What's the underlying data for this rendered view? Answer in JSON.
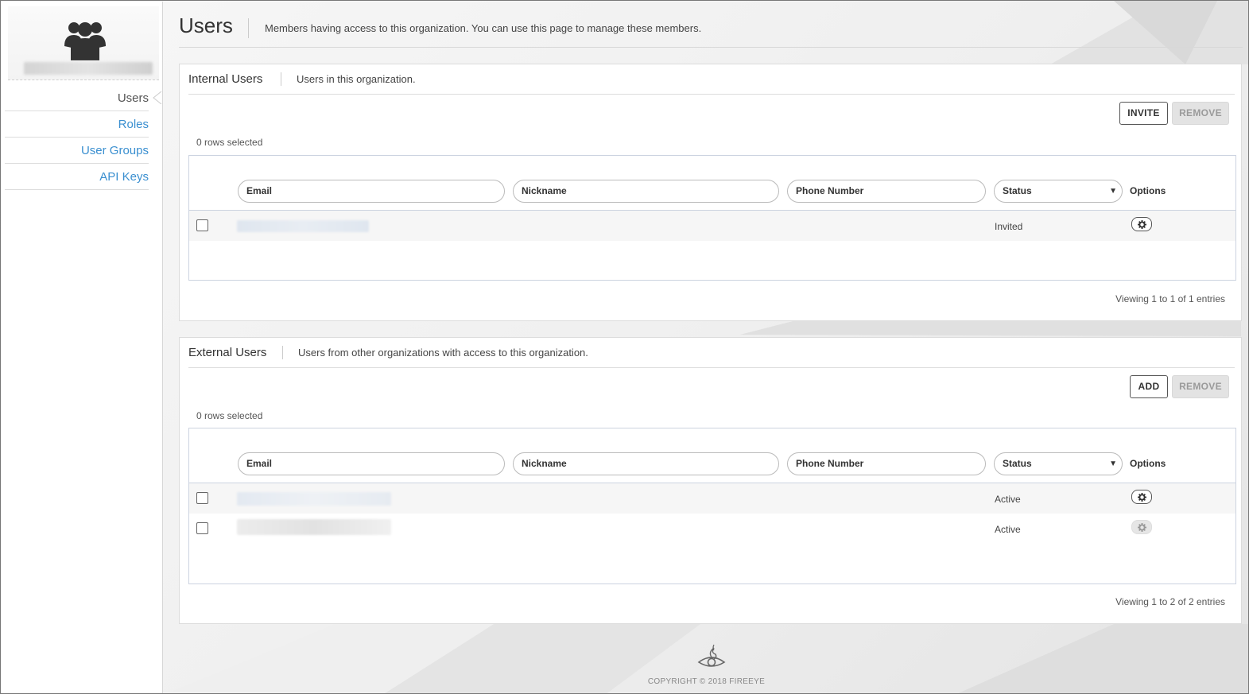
{
  "sidebar": {
    "org_icon": "users-group-icon",
    "items": [
      {
        "label": "Users",
        "active": true
      },
      {
        "label": "Roles",
        "active": false
      },
      {
        "label": "User Groups",
        "active": false
      },
      {
        "label": "API Keys",
        "active": false
      }
    ]
  },
  "header": {
    "title": "Users",
    "description": "Members having access to this organization. You can use this page to manage these members."
  },
  "internal_users": {
    "title": "Internal Users",
    "description": "Users in this organization.",
    "primary_button": "INVITE",
    "remove_button": "REMOVE",
    "rows_selected": "0 rows selected",
    "columns": {
      "email": "Email",
      "nickname": "Nickname",
      "phone": "Phone Number",
      "status": "Status",
      "options": "Options"
    },
    "rows": [
      {
        "status": "Invited",
        "options_enabled": true
      }
    ],
    "viewing": "Viewing 1 to 1 of 1 entries"
  },
  "external_users": {
    "title": "External Users",
    "description": "Users from other organizations with access to this organization.",
    "primary_button": "ADD",
    "remove_button": "REMOVE",
    "rows_selected": "0 rows selected",
    "columns": {
      "email": "Email",
      "nickname": "Nickname",
      "phone": "Phone Number",
      "status": "Status",
      "options": "Options"
    },
    "rows": [
      {
        "status": "Active",
        "options_enabled": true
      },
      {
        "status": "Active",
        "options_enabled": false
      }
    ],
    "viewing": "Viewing 1 to 2 of 2 entries"
  },
  "footer": {
    "logo_icon": "fireeye-logo-icon",
    "copyright": "COPYRIGHT © 2018 FIREEYE"
  },
  "colors": {
    "link": "#3a8fd0",
    "disabled_button": "#e3e3e3",
    "grid_border": "#ccd3e0"
  }
}
